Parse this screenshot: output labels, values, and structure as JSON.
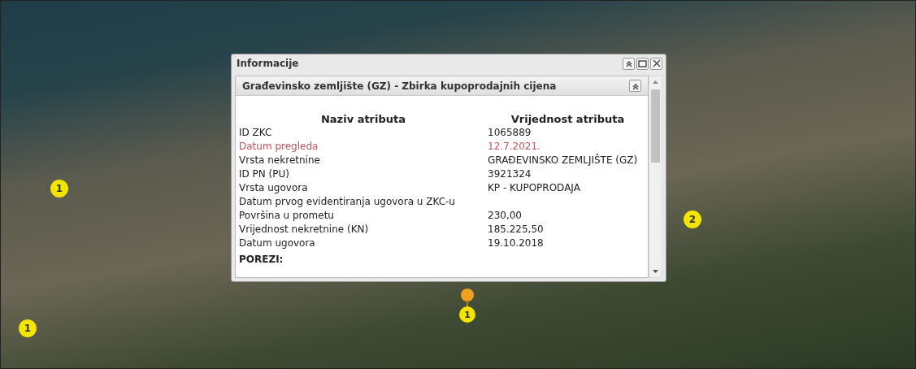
{
  "map": {
    "markers": [
      {
        "label": "1",
        "kind": "circle"
      },
      {
        "label": "2",
        "kind": "circle"
      },
      {
        "label": "1",
        "kind": "circle"
      },
      {
        "label": "1",
        "kind": "pin"
      }
    ]
  },
  "popup": {
    "title": "Informacije",
    "section": {
      "title": "Građevinsko zemljište (GZ) - Zbirka kupoprodajnih cijena",
      "columns": [
        "Naziv atributa",
        "Vrijednost atributa"
      ],
      "rows": [
        {
          "kind": "attribute",
          "label": "ID ZKC",
          "value": "1065889",
          "highlighted": false
        },
        {
          "kind": "attribute",
          "label": "Datum pregleda",
          "value": "12.7.2021.",
          "highlighted": true
        },
        {
          "kind": "attribute",
          "label": "Vrsta nekretnine",
          "value": "GRAĐEVINSKO ZEMLJIŠTE (GZ)",
          "highlighted": false
        },
        {
          "kind": "attribute",
          "label": "ID PN (PU)",
          "value": "3921324",
          "highlighted": false
        },
        {
          "kind": "attribute",
          "label": "Vrsta ugovora",
          "value": "KP - KUPOPRODAJA",
          "highlighted": false
        },
        {
          "kind": "attribute",
          "label": "Datum prvog evidentiranja ugovora u ZKC-u",
          "highlighted": false
        },
        {
          "kind": "attribute",
          "label": "Površina u prometu",
          "value": "230,00",
          "highlighted": false
        },
        {
          "kind": "attribute",
          "label": "Vrijednost nekretnine (KN)",
          "value": "185.225,50",
          "highlighted": false
        },
        {
          "kind": "attribute",
          "label": "Datum ugovora",
          "value": "19.10.2018",
          "highlighted": false
        },
        {
          "kind": "section",
          "label": "POREZI:"
        }
      ]
    }
  }
}
